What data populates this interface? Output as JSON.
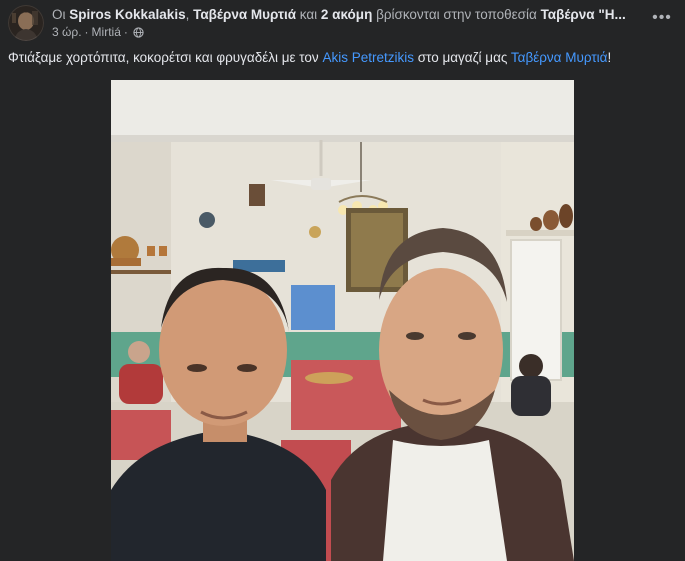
{
  "post": {
    "header": {
      "prefix": "Οι ",
      "person1": "Spiros Kokkalakis",
      "sep": ", ",
      "person2": "Ταβέρνα Μυρτιά",
      "and": " και ",
      "others": "2 ακόμη",
      "middle": " βρίσκονται στην τοποθεσία ",
      "place": "Ταβέρνα \"Η...",
      "time": "3 ώρ.",
      "dot": "·",
      "location": "Mirtiá",
      "dot2": "·"
    },
    "text": {
      "part1": "Φτιάξαμε χορτόπιτα, κοκορέτσι και φρυγαδέλι με τον ",
      "tag1": "Akis Petretzikis",
      "part2": " στο μαγαζί μας ",
      "tag2": "Ταβέρνα Μυρτιά",
      "part3": "!"
    },
    "more_label": "•••",
    "icons": {
      "globe": "globe-icon",
      "more": "more-horizontal-icon"
    },
    "colors": {
      "background": "#242526",
      "link": "#4599ff",
      "text": "#e4e6eb",
      "secondary": "#b0b3b8"
    }
  }
}
